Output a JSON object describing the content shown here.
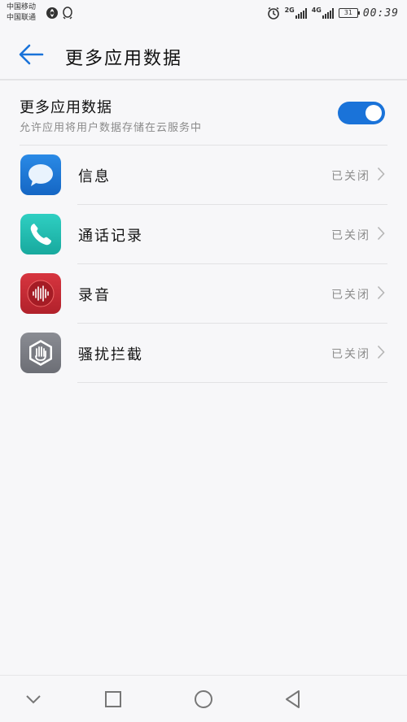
{
  "status_bar": {
    "carrier_line1": "中国移动",
    "carrier_line2": "中国联通",
    "network_1": "2G",
    "network_2": "4G",
    "battery_level": "31",
    "time": "00:39",
    "icons": [
      "hotspot-icon",
      "qq-icon",
      "alarm-icon",
      "signal-icon",
      "signal-icon",
      "battery-icon"
    ]
  },
  "header": {
    "title": "更多应用数据",
    "back_icon": "back-arrow-icon",
    "accent_color": "#1a73d9"
  },
  "master": {
    "title": "更多应用数据",
    "description": "允许应用将用户数据存储在云服务中",
    "toggle_on": true
  },
  "apps": [
    {
      "label": "信息",
      "status": "已关闭",
      "icon": "message-icon",
      "icon_color": "#1f7ad6"
    },
    {
      "label": "通话记录",
      "status": "已关闭",
      "icon": "phone-icon",
      "icon_color": "#1fbfb3"
    },
    {
      "label": "录音",
      "status": "已关闭",
      "icon": "recorder-icon",
      "icon_color": "#c62b35"
    },
    {
      "label": "骚扰拦截",
      "status": "已关闭",
      "icon": "harassment-block-icon",
      "icon_color": "#7d7f86"
    }
  ],
  "nav_bar": {
    "icons": [
      "collapse-icon",
      "recents-icon",
      "home-icon",
      "back-icon"
    ]
  }
}
